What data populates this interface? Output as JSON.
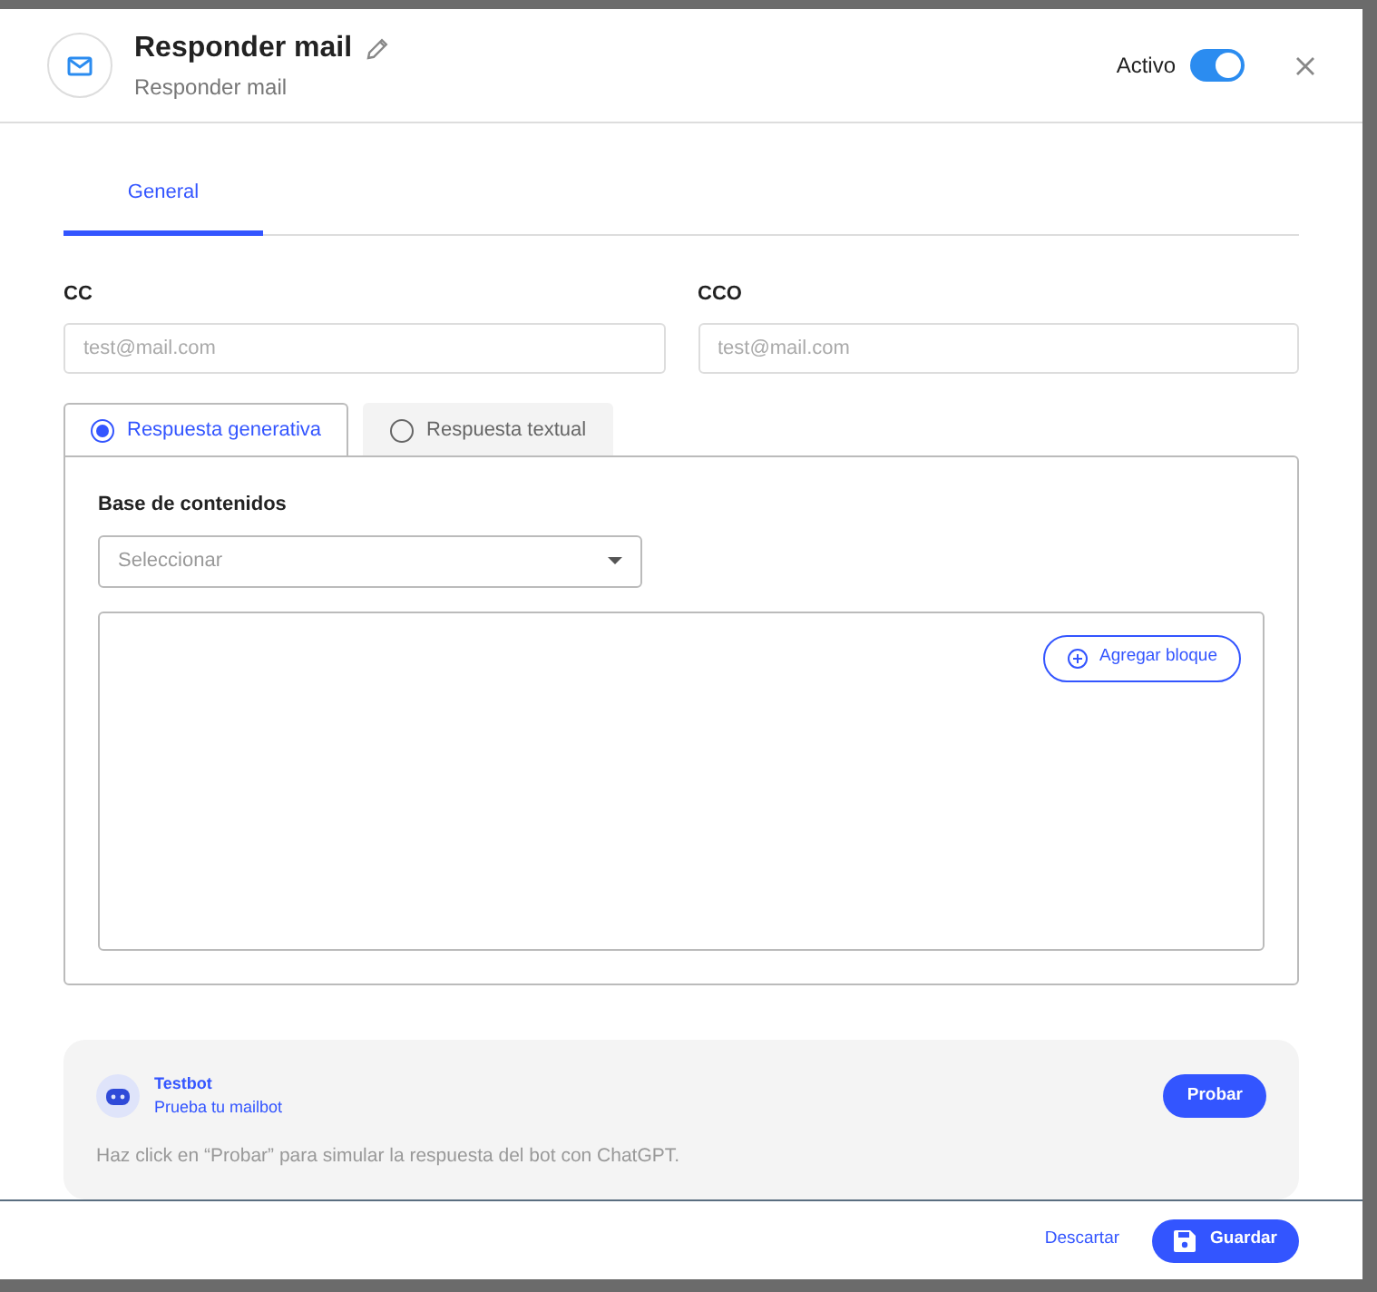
{
  "dialog": {
    "title": "Responder mail",
    "subtitle": "Responder mail",
    "active_label": "Activo",
    "active": true
  },
  "tabs": [
    {
      "label": "General",
      "selected": true
    }
  ],
  "fields": [
    {
      "label": "CC",
      "placeholder": "test@mail.com"
    },
    {
      "label": "CCO",
      "placeholder": "test@mail.com"
    }
  ],
  "response_tabs": [
    {
      "label": "Respuesta generativa",
      "selected": true
    },
    {
      "label": "Respuesta textual",
      "selected": false
    }
  ],
  "content_base": {
    "label": "Base de contenidos",
    "placeholder": "Seleccionar"
  },
  "add_block_button": "Agregar bloque",
  "testbot": {
    "title": "Testbot",
    "subtitle": "Prueba tu mailbot",
    "button": "Probar",
    "hint": "Haz click en “Probar” para simular la respuesta del bot con ChatGPT."
  },
  "footer": {
    "discard": "Descartar",
    "save": "Guardar"
  }
}
